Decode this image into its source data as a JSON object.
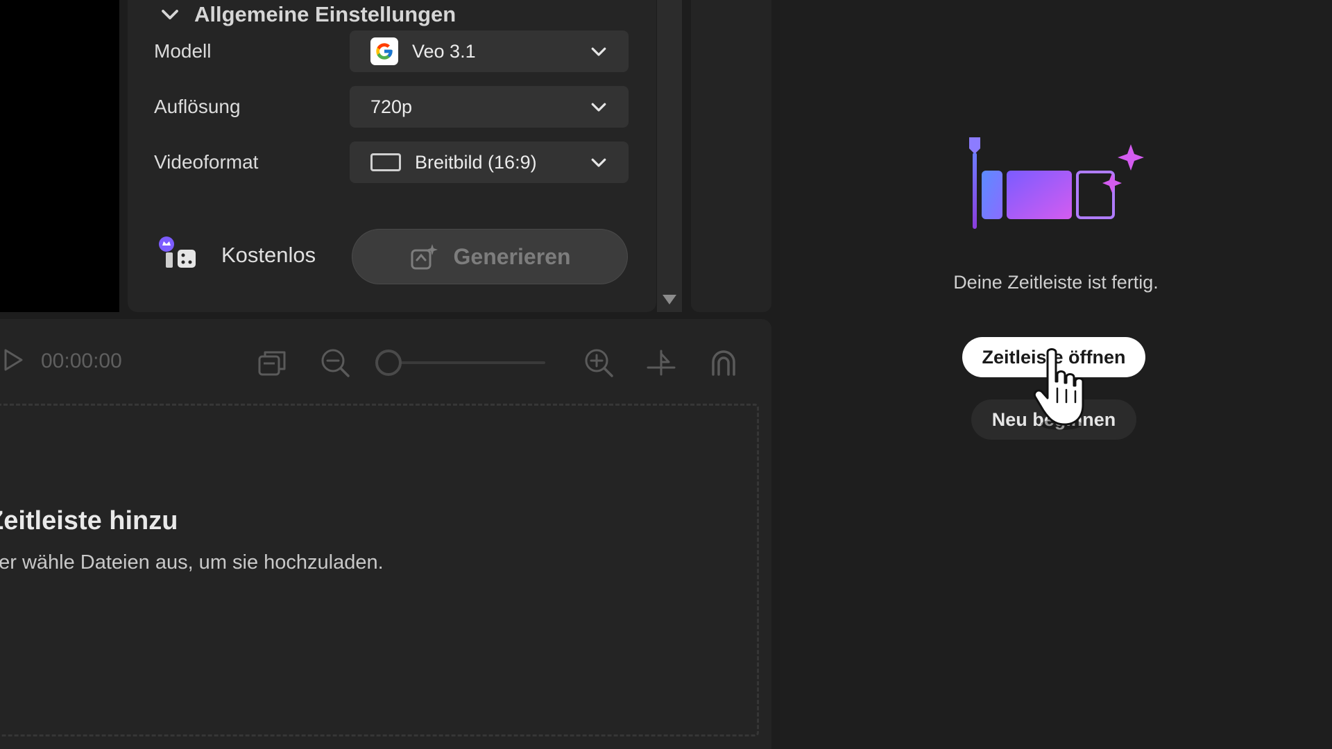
{
  "settings": {
    "section_title": "Allgemeine Einstellungen",
    "rows": [
      {
        "label": "Modell",
        "value": "Veo 3.1",
        "icon": "google-icon"
      },
      {
        "label": "Auflösung",
        "value": "720p"
      },
      {
        "label": "Videoformat",
        "value": "Breitbild (16:9)",
        "icon": "aspect-ratio-icon"
      }
    ],
    "credit_label": "Kostenlos",
    "generate_label": "Generieren"
  },
  "timeline": {
    "timecode": "00:00:00",
    "zoom_level": 0,
    "drop_title": "Zeitleiste hinzu",
    "drop_subtitle": "der wähle Dateien aus, um sie hochzuladen."
  },
  "right_panel": {
    "ready_text": "Deine Zeitleiste ist fertig.",
    "open_button": "Zeitleiste öffnen",
    "restart_button": "Neu beginnen"
  },
  "colors": {
    "accent_purple": "#a855f7",
    "accent_blue": "#6d7dff",
    "accent_pink": "#d45cf0"
  }
}
